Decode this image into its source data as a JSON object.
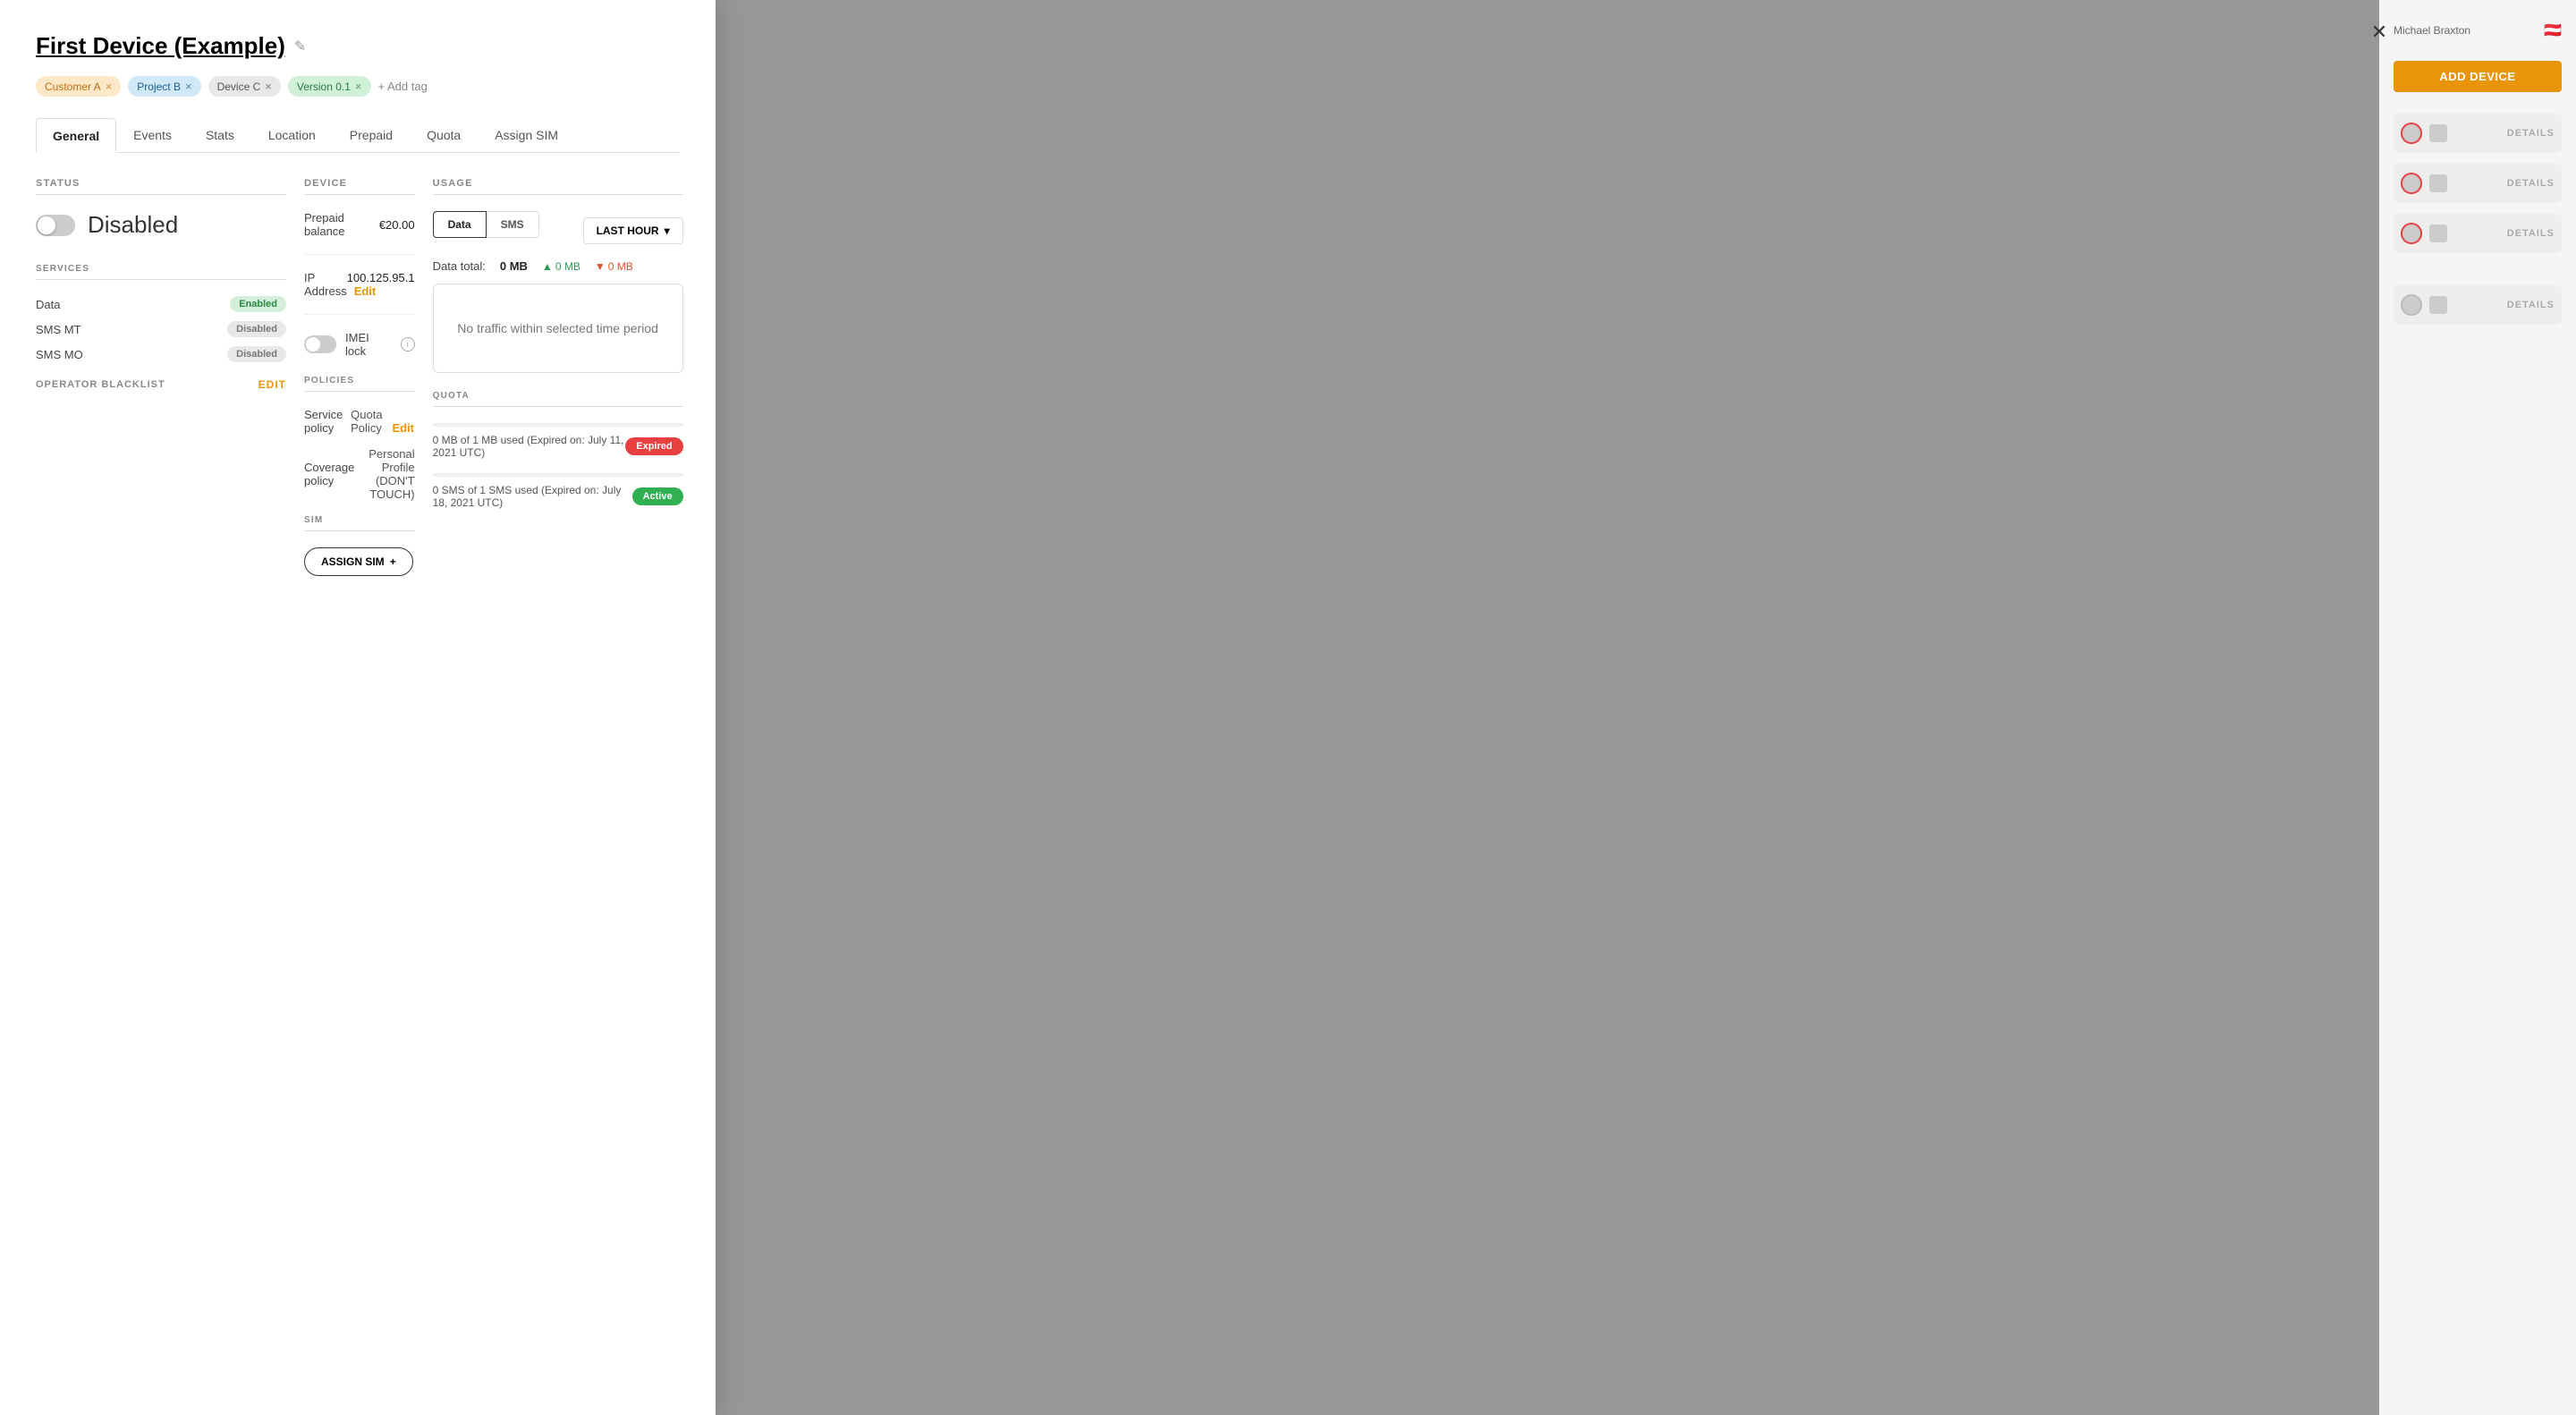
{
  "modal": {
    "title": "First Device (Example)",
    "edit_icon": "✎",
    "close_icon": "✕"
  },
  "tags": [
    {
      "id": "tag-customer",
      "label": "Customer A",
      "style": "orange"
    },
    {
      "id": "tag-project",
      "label": "Project B",
      "style": "blue"
    },
    {
      "id": "tag-device",
      "label": "Device C",
      "style": "gray"
    },
    {
      "id": "tag-version",
      "label": "Version 0.1",
      "style": "green"
    }
  ],
  "add_tag_label": "+ Add tag",
  "tabs": [
    {
      "id": "general",
      "label": "General",
      "active": true
    },
    {
      "id": "events",
      "label": "Events",
      "active": false
    },
    {
      "id": "stats",
      "label": "Stats",
      "active": false
    },
    {
      "id": "location",
      "label": "Location",
      "active": false
    },
    {
      "id": "prepaid",
      "label": "Prepaid",
      "active": false
    },
    {
      "id": "quota",
      "label": "Quota",
      "active": false
    },
    {
      "id": "assign-sim",
      "label": "Assign SIM",
      "active": false
    }
  ],
  "status": {
    "section_title": "STATUS",
    "toggle_state": "off",
    "status_label": "Disabled",
    "services_title": "SERVICES",
    "services": [
      {
        "name": "Data",
        "status": "Enabled",
        "type": "enabled"
      },
      {
        "name": "SMS MT",
        "status": "Disabled",
        "type": "disabled"
      },
      {
        "name": "SMS MO",
        "status": "Disabled",
        "type": "disabled"
      }
    ],
    "operator_blacklist_label": "OPERATOR BLACKLIST",
    "operator_blacklist_edit": "Edit"
  },
  "device": {
    "section_title": "DEVICE",
    "prepaid_balance_label": "Prepaid balance",
    "prepaid_balance_value": "€20.00",
    "ip_address_label": "IP Address",
    "ip_address_value": "100.125.95.1",
    "ip_address_edit": "Edit",
    "imei_lock_label": "IMEI lock",
    "policies_title": "POLICIES",
    "service_policy_label": "Service policy",
    "service_policy_value": "Quota Policy",
    "service_policy_edit": "Edit",
    "coverage_policy_label": "Coverage policy",
    "coverage_policy_value": "Personal Profile (DON'T TOUCH)",
    "sim_title": "SIM",
    "assign_sim_label": "ASSIGN SIM",
    "assign_sim_plus": "+"
  },
  "usage": {
    "section_title": "USAGE",
    "tab_data": "Data",
    "tab_sms": "SMS",
    "period_label": "LAST HOUR",
    "data_total_label": "Data total:",
    "data_total_value": "0 MB",
    "upload_label": "0 MB",
    "download_label": "0 MB",
    "no_traffic_message": "No traffic within selected time period",
    "quota_title": "QUOTA",
    "quota_items": [
      {
        "description": "0 MB of 1 MB used (Expired on: July 11, 2021 UTC)",
        "badge": "Expired",
        "badge_type": "expired",
        "fill_pct": 0
      },
      {
        "description": "0 SMS of 1 SMS used (Expired on: July 18, 2021 UTC)",
        "badge": "Active",
        "badge_type": "active",
        "fill_pct": 0
      }
    ]
  },
  "right_panel": {
    "add_device_label": "ADD DEVICE",
    "rows": [
      {
        "id": "row1"
      },
      {
        "id": "row2"
      },
      {
        "id": "row3"
      },
      {
        "id": "row4"
      }
    ],
    "details_label": "DETAILS"
  }
}
